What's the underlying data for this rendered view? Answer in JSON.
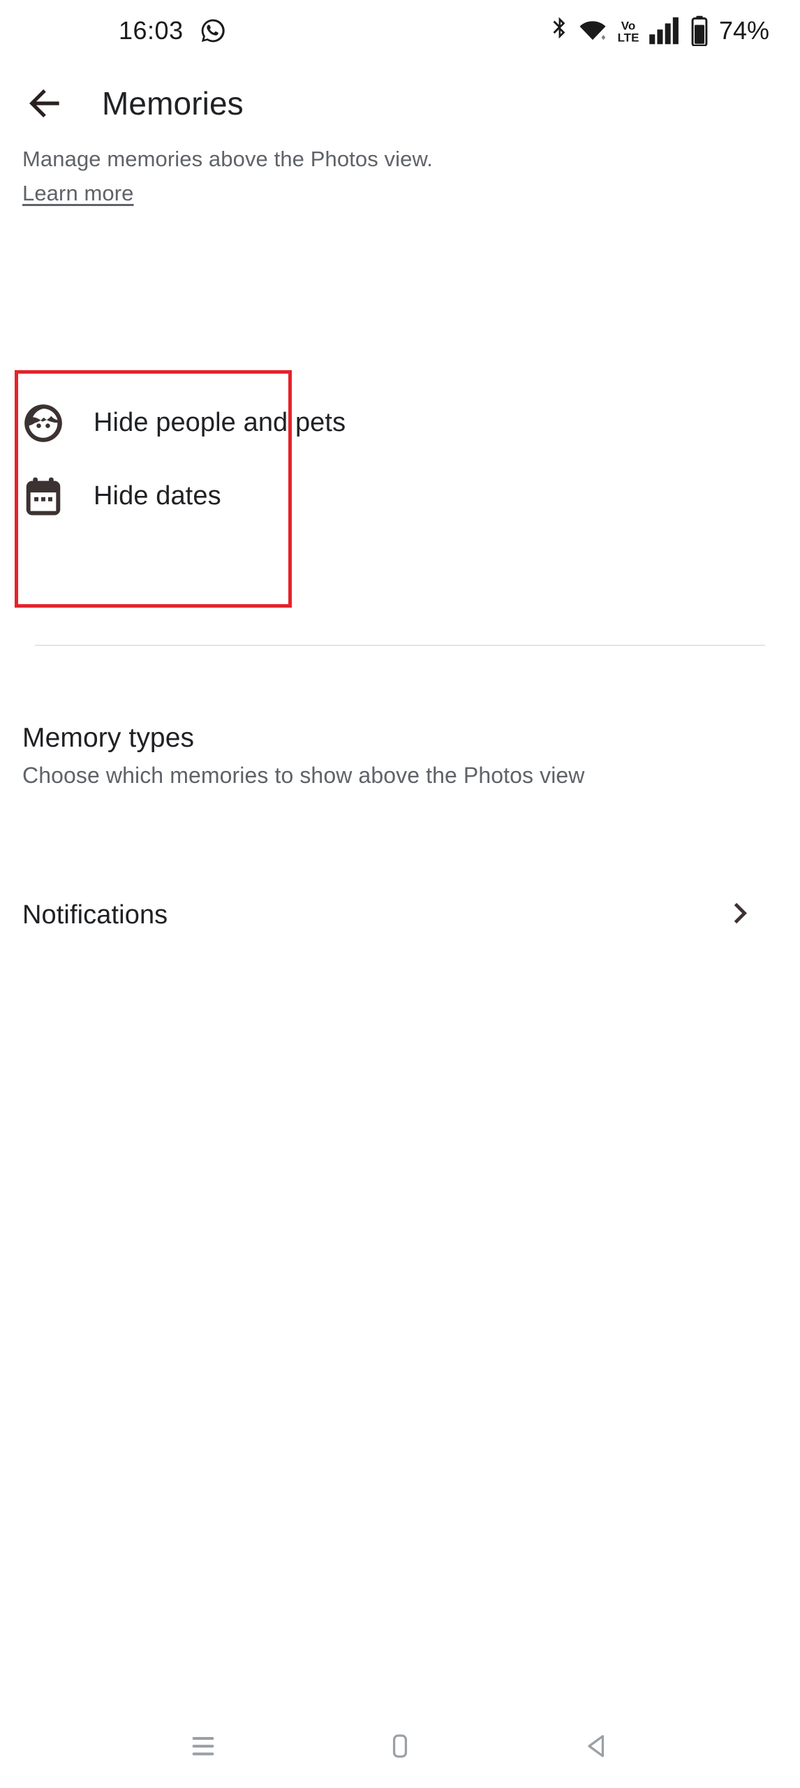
{
  "status_bar": {
    "time": "16:03",
    "app_icon": "whatsapp-icon",
    "indicators": [
      "bluetooth-icon",
      "wifi-icon",
      "volte-icon",
      "cellular-signal-icon",
      "battery-icon"
    ],
    "volte_label_top": "Vo",
    "volte_label_bottom": "LTE",
    "battery_percent": "74%"
  },
  "app_bar": {
    "back_label": "back-arrow",
    "title": "Memories"
  },
  "description": {
    "text": "Manage memories above the Photos view.",
    "link_label": "Learn more"
  },
  "hide_options": [
    {
      "icon": "person-face-icon",
      "label": "Hide people and pets"
    },
    {
      "icon": "calendar-icon",
      "label": "Hide dates"
    }
  ],
  "highlight": {
    "color": "#e3242b",
    "border_width_px": 5
  },
  "memory_types": {
    "title": "Memory types",
    "subtitle": "Choose which memories to show above the Photos view"
  },
  "notifications_row": {
    "label": "Notifications",
    "chevron": "chevron-right-icon"
  },
  "system_nav": {
    "recents": "recents-icon",
    "home": "home-icon",
    "back": "back-triangle-icon"
  },
  "colors": {
    "text_primary": "#202124",
    "text_secondary": "#5f6368",
    "icon_dark": "#3c3231",
    "divider": "#e4e4e4",
    "highlight_red": "#e3242b",
    "background": "#ffffff"
  }
}
